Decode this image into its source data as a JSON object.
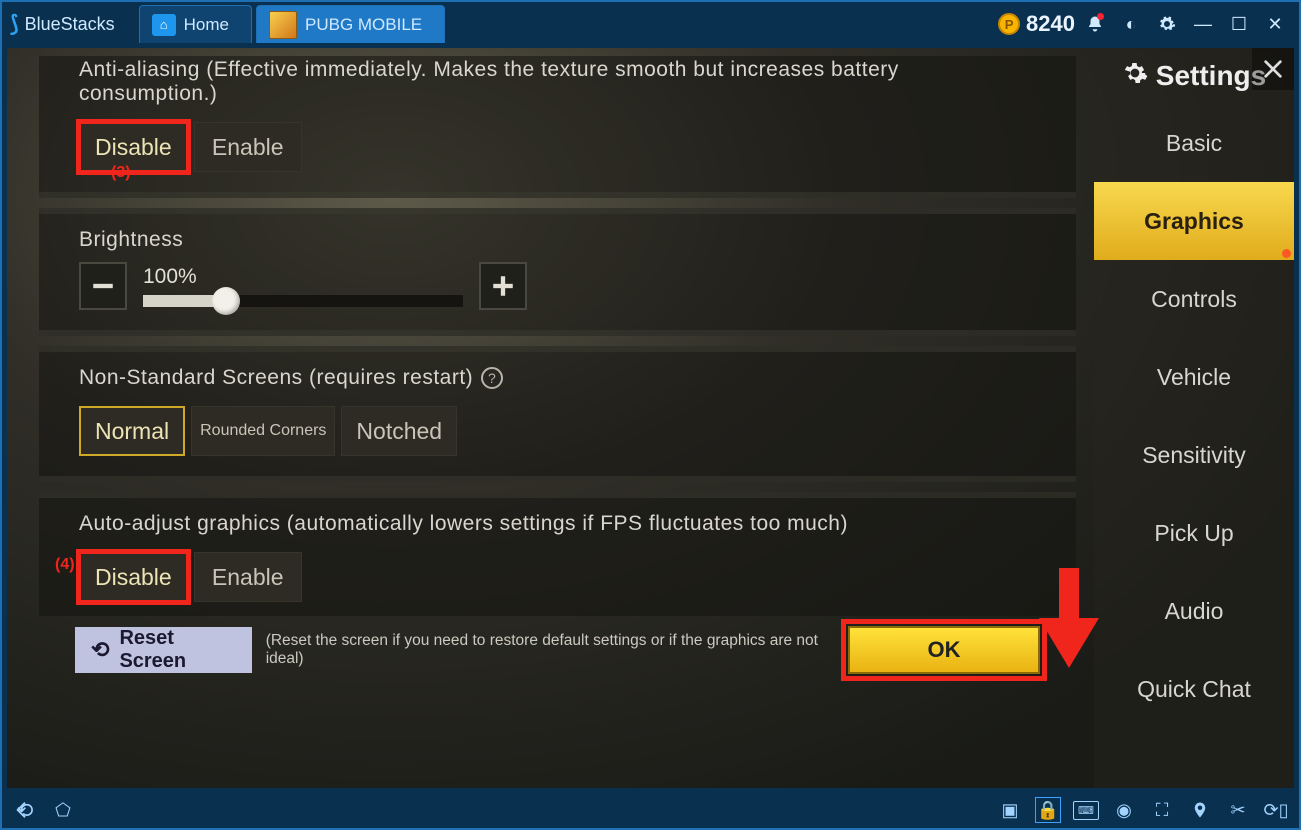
{
  "titlebar": {
    "app_name": "BlueStacks",
    "tabs": [
      {
        "label": "Home"
      },
      {
        "label": "PUBG MOBILE"
      }
    ],
    "currency_value": "8240"
  },
  "settings": {
    "header": "Settings",
    "menu": [
      "Basic",
      "Graphics",
      "Controls",
      "Vehicle",
      "Sensitivity",
      "Pick Up",
      "Audio",
      "Quick Chat"
    ],
    "active_menu_index": 1
  },
  "anti_aliasing": {
    "label": "Anti-aliasing (Effective immediately. Makes the texture smooth but increases battery consumption.)",
    "options": [
      "Disable",
      "Enable"
    ],
    "selected": 0,
    "annotation": "(3)"
  },
  "brightness": {
    "label": "Brightness",
    "value": "100%"
  },
  "non_standard": {
    "label": "Non-Standard Screens (requires restart)",
    "options": [
      "Normal",
      "Rounded Corners",
      "Notched"
    ],
    "selected": 0
  },
  "auto_adjust": {
    "label": "Auto-adjust graphics (automatically lowers settings if FPS fluctuates too much)",
    "options": [
      "Disable",
      "Enable"
    ],
    "selected": 0,
    "annotation": "(4)"
  },
  "actions": {
    "reset_label": "Reset Screen",
    "reset_desc": "(Reset the screen if you need to restore default settings or if the graphics are not ideal)",
    "ok_label": "OK"
  }
}
